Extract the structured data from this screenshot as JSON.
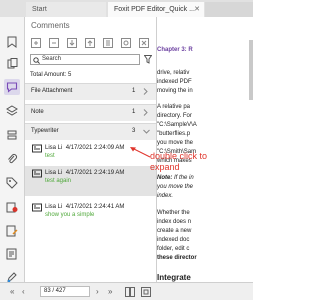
{
  "tabs": {
    "start": "Start",
    "doc": "Foxit PDF Editor_Quick ...",
    "close": "✕"
  },
  "panel": {
    "title": "Comments",
    "search_placeholder": "Search",
    "total": "Total Amount: 5"
  },
  "groups": [
    {
      "label": "File Attachment",
      "count": "1",
      "expanded": false
    },
    {
      "label": "Note",
      "count": "1",
      "expanded": false
    },
    {
      "label": "Typewriter",
      "count": "3",
      "expanded": true
    }
  ],
  "comments": [
    {
      "author": "Lisa Li",
      "date": "4/17/2021 2:24:09 AM",
      "text": "test",
      "selected": false
    },
    {
      "author": "Lisa Li",
      "date": "4/17/2021 2:24:19 AM",
      "text": "test again",
      "selected": true
    },
    {
      "author": "Lisa Li",
      "date": "4/17/2021 2:24:41 AM",
      "text": "show you a simple",
      "selected": false
    }
  ],
  "annotation": {
    "line1": "double click to",
    "line2": "expand"
  },
  "nav": {
    "page": "83 / 427"
  },
  "doc": {
    "heading": "Chapter 3: R",
    "lines": [
      "drive, relativ",
      "indexed PDF",
      "moving the in",
      "",
      "A relative pa",
      "directory. For",
      "\"C:\\SampleV\\A",
      "\"butterflies.p",
      "you move the",
      "\"C:\\Smith\\Sam",
      "which makes",
      ""
    ],
    "note_lead": "Note:",
    "note_rest": " If the in",
    "note_lines": [
      "you move the",
      "index."
    ],
    "tail_lines": [
      "Whether the",
      "index does n",
      "create a new",
      "indexed doc",
      "folder, edit c"
    ],
    "tail_bold": "these director",
    "section": "Integrate"
  },
  "colors": {
    "accent": "#6b3fa0",
    "comment_text": "#4fa83a",
    "annotation": "#e0362d"
  }
}
